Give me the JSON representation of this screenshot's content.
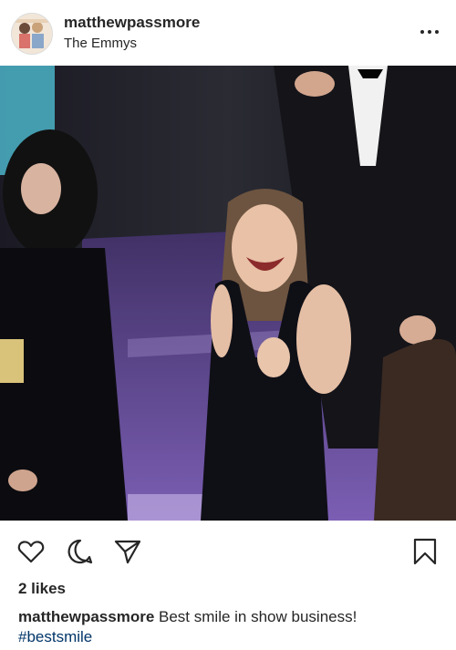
{
  "post": {
    "username": "matthewpassmore",
    "location": "The Emmys",
    "likes": "2 likes",
    "caption": {
      "username": "matthewpassmore",
      "text": "Best smile in show business!",
      "hashtag": "#bestsmile"
    }
  },
  "icons": {
    "more": "more-options-icon",
    "like": "heart-icon",
    "comment": "comment-icon",
    "share": "paper-plane-icon",
    "save": "bookmark-icon"
  },
  "colors": {
    "text": "#262626",
    "hashtag": "#003569",
    "carpet": "#6a4fa0",
    "background": "#ffffff"
  }
}
